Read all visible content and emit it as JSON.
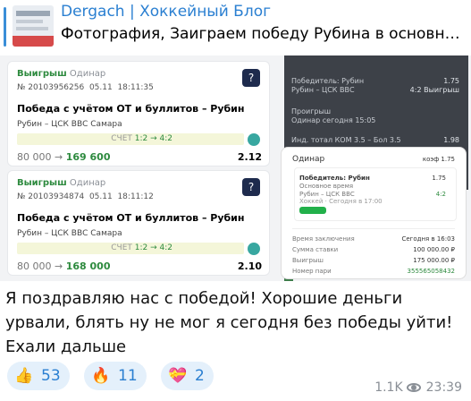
{
  "reply": {
    "title": "Dergach | Хоккейный Блог",
    "text": "Фотография, Заиграем победу Рубина в основное в..."
  },
  "slips": [
    {
      "status": "Выигрыш",
      "type": "Одинар",
      "number": "№ 20103956256",
      "date": "05.11",
      "time": "18:11:35",
      "bet": "Победа с учётом ОТ и буллитов – Рубин",
      "match": "Рубин – ЦСК ВВС Самара",
      "score_label": "СЧЕТ",
      "score": "1:2 → 4:2",
      "stake": "80 000",
      "win": "169 600",
      "odds": "2.12"
    },
    {
      "status": "Выигрыш",
      "type": "Одинар",
      "number": "№ 20103934874",
      "date": "05.11",
      "time": "18:11:12",
      "bet": "Победа с учётом ОТ и буллитов – Рубин",
      "match": "Рубин – ЦСК ВВС Самара",
      "score_label": "СЧЕТ",
      "score": "1:2 → 4:2",
      "stake": "80 000",
      "win": "168 000",
      "odds": "2.10"
    }
  ],
  "dark_panel": {
    "rows": [
      {
        "text": "Победитель: Рубин",
        "odd": "1.75"
      },
      {
        "text": "Рубин – ЦСК ВВС",
        "odd": "4:2 Выигрыш"
      },
      {
        "text": "Проигрыш",
        "odd": ""
      },
      {
        "text": "Одинар сегодня 15:05",
        "odd": ""
      },
      {
        "text": "Инд. тотал КОМ 3.5 – Бол 3.5",
        "odd": "1.98"
      }
    ]
  },
  "receipt": {
    "type": "Одинар",
    "coef": "коэф 1.75",
    "pick": "Победитель: Рубин",
    "pick_odd": "1.75",
    "pick_sub": "Основное время",
    "match": "Рубин – ЦСК ВВС",
    "match_score": "4:2",
    "league": "Хоккей · Сегодня в 17:00",
    "badge": "Выигрыш",
    "rows": [
      {
        "label": "Время заключения",
        "value": "Сегодня в 16:03"
      },
      {
        "label": "Сумма ставки",
        "value": "100 000.00 ₽"
      },
      {
        "label": "Выигрыш",
        "value": "175 000.00 ₽"
      },
      {
        "label": "Номер пари",
        "value": "355565058432"
      }
    ]
  },
  "message": "Я поздравляю нас с победой! Хорошие деньги урвали, блять ну не мог я сегодня без победы уйти! Ехали дальше",
  "reactions": [
    {
      "icon": "👍",
      "count": "53"
    },
    {
      "icon": "🔥",
      "count": "11"
    },
    {
      "icon": "💝",
      "count": "2"
    }
  ],
  "meta": {
    "views": "1.1K",
    "time": "23:39"
  },
  "colors": {
    "link": "#2a7fd1",
    "win_green": "#2d8a3e",
    "reaction_bg": "#e4f0fb"
  }
}
